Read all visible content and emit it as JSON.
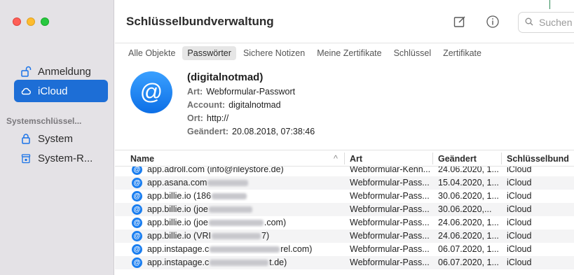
{
  "window": {
    "title": "Schlüsselbundverwaltung"
  },
  "sidebar": {
    "items": [
      {
        "label": "Anmeldung",
        "icon": "unlock-icon"
      },
      {
        "label": "iCloud",
        "icon": "cloud-icon",
        "active": true
      }
    ],
    "section_label": "Systemschlüssel...",
    "system_items": [
      {
        "label": "System",
        "icon": "lock-icon"
      },
      {
        "label": "System-R...",
        "icon": "archive-lock-icon"
      }
    ]
  },
  "toolbar": {
    "compose_icon": "compose-icon",
    "info_icon": "info-icon",
    "search_placeholder": "Suchen"
  },
  "tabs": [
    "Alle Objekte",
    "Passwörter",
    "Sichere Notizen",
    "Meine Zertifikate",
    "Schlüssel",
    "Zertifikate"
  ],
  "active_tab": "Passwörter",
  "detail": {
    "name": "(digitalnotmad)",
    "art_label": "Art:",
    "art_value": "Webformular-Passwort",
    "account_label": "Account:",
    "account_value": "digitalnotmad",
    "ort_label": "Ort:",
    "ort_value": "http://",
    "geaendert_label": "Geändert:",
    "geaendert_value": "20.08.2018, 07:38:46"
  },
  "table": {
    "columns": [
      "Name",
      "Art",
      "Geändert",
      "Schlüsselbund"
    ],
    "sort_indicator": "^",
    "rows": [
      {
        "name_a": "app.adroll.com (info@rileystore.de)",
        "name_b": "",
        "art": "Webformular-Kenn...",
        "geaendert": "24.06.2020, 1...",
        "bund": "iCloud"
      },
      {
        "name_a": "app.asana.com",
        "name_b": "",
        "art": "Webformular-Pass...",
        "geaendert": "15.04.2020, 1...",
        "bund": "iCloud"
      },
      {
        "name_a": "app.billie.io (186",
        "name_b": "",
        "art": "Webformular-Pass...",
        "geaendert": "30.06.2020, 1...",
        "bund": "iCloud"
      },
      {
        "name_a": "app.billie.io (joe",
        "name_b": "",
        "art": "Webformular-Pass...",
        "geaendert": "30.06.2020,...",
        "bund": "iCloud"
      },
      {
        "name_a": "app.billie.io (joe",
        "name_b": ".com)",
        "art": "Webformular-Pass...",
        "geaendert": "24.06.2020, 1...",
        "bund": "iCloud"
      },
      {
        "name_a": "app.billie.io (VRI",
        "name_b": "7)",
        "art": "Webformular-Pass...",
        "geaendert": "24.06.2020, 1...",
        "bund": "iCloud"
      },
      {
        "name_a": "app.instapage.c",
        "name_b": "rel.com)",
        "art": "Webformular-Pass...",
        "geaendert": "06.07.2020, 1...",
        "bund": "iCloud"
      },
      {
        "name_a": "app.instapage.c",
        "name_b": "t.de)",
        "art": "Webformular-Pass...",
        "geaendert": "06.07.2020, 1...",
        "bund": "iCloud"
      }
    ]
  },
  "colors": {
    "accent": "#1d6ed6",
    "sidebar_bg": "#e4e2e6",
    "icon_blue": "#1a7ef0"
  }
}
